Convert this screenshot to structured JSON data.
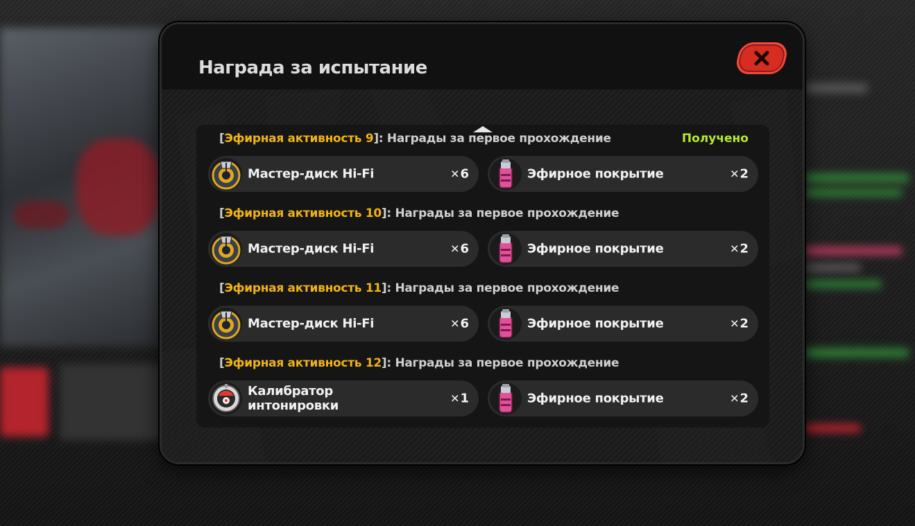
{
  "dialog": {
    "title": "Награда за испытание",
    "close_label": "✕"
  },
  "reward_groups": [
    {
      "open_bracket": "[",
      "stage": "Эфирная активность 9",
      "suffix": "]: Награды за первое прохождение",
      "status": "Получено",
      "items": [
        {
          "name": "Мастер-диск Hi-Fi",
          "qty_mark": "✕",
          "qty": "6",
          "icon": "master-disk-hifi-icon"
        },
        {
          "name": "Эфирное покрытие",
          "qty_mark": "✕",
          "qty": "2",
          "icon": "ether-coating-icon"
        }
      ]
    },
    {
      "open_bracket": "[",
      "stage": "Эфирная активность 10",
      "suffix": "]: Награды за первое прохождение",
      "status": "",
      "items": [
        {
          "name": "Мастер-диск Hi-Fi",
          "qty_mark": "✕",
          "qty": "6",
          "icon": "master-disk-hifi-icon"
        },
        {
          "name": "Эфирное покрытие",
          "qty_mark": "✕",
          "qty": "2",
          "icon": "ether-coating-icon"
        }
      ]
    },
    {
      "open_bracket": "[",
      "stage": "Эфирная активность 11",
      "suffix": "]: Награды за первое прохождение",
      "status": "",
      "items": [
        {
          "name": "Мастер-диск Hi-Fi",
          "qty_mark": "✕",
          "qty": "6",
          "icon": "master-disk-hifi-icon"
        },
        {
          "name": "Эфирное покрытие",
          "qty_mark": "✕",
          "qty": "2",
          "icon": "ether-coating-icon"
        }
      ]
    },
    {
      "open_bracket": "[",
      "stage": "Эфирная активность 12",
      "suffix": "]: Награды за первое прохождение",
      "status": "",
      "items": [
        {
          "name": "Калибратор\nинтонировки",
          "qty_mark": "✕",
          "qty": "1",
          "icon": "intonation-calibrator-icon"
        },
        {
          "name": "Эфирное покрытие",
          "qty_mark": "✕",
          "qty": "2",
          "icon": "ether-coating-icon"
        }
      ]
    }
  ],
  "colors": {
    "stage_highlight": "#f1b315",
    "status_received": "#b6ea2a",
    "close_button": "#d62c22"
  }
}
